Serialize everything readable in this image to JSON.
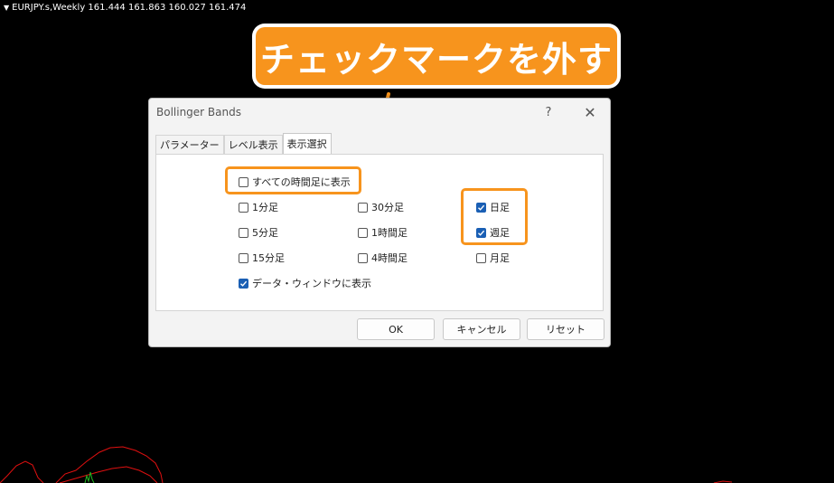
{
  "chart": {
    "symbol_line": "EURJPY.s,Weekly  161.444 161.863 160.027 161.474"
  },
  "callout": {
    "text": "チェックマークを外す",
    "color": "#f7941d"
  },
  "dialog": {
    "title": "Bollinger Bands",
    "help_icon": "?",
    "close_icon": "✕",
    "tabs": [
      {
        "label": "パラメーター",
        "active": false
      },
      {
        "label": "レベル表示",
        "active": false
      },
      {
        "label": "表示選択",
        "active": true
      }
    ],
    "all_timeframes": {
      "label": "すべての時間足に表示",
      "checked": false
    },
    "timeframes": [
      {
        "label": "1分足",
        "checked": false
      },
      {
        "label": "30分足",
        "checked": false
      },
      {
        "label": "日足",
        "checked": true
      },
      {
        "label": "5分足",
        "checked": false
      },
      {
        "label": "1時間足",
        "checked": false
      },
      {
        "label": "週足",
        "checked": true
      },
      {
        "label": "15分足",
        "checked": false
      },
      {
        "label": "4時間足",
        "checked": false
      },
      {
        "label": "月足",
        "checked": false
      }
    ],
    "data_window": {
      "label": "データ・ウィンドウに表示",
      "checked": true
    },
    "buttons": {
      "ok": "OK",
      "cancel": "キャンセル",
      "reset": "リセット"
    }
  }
}
